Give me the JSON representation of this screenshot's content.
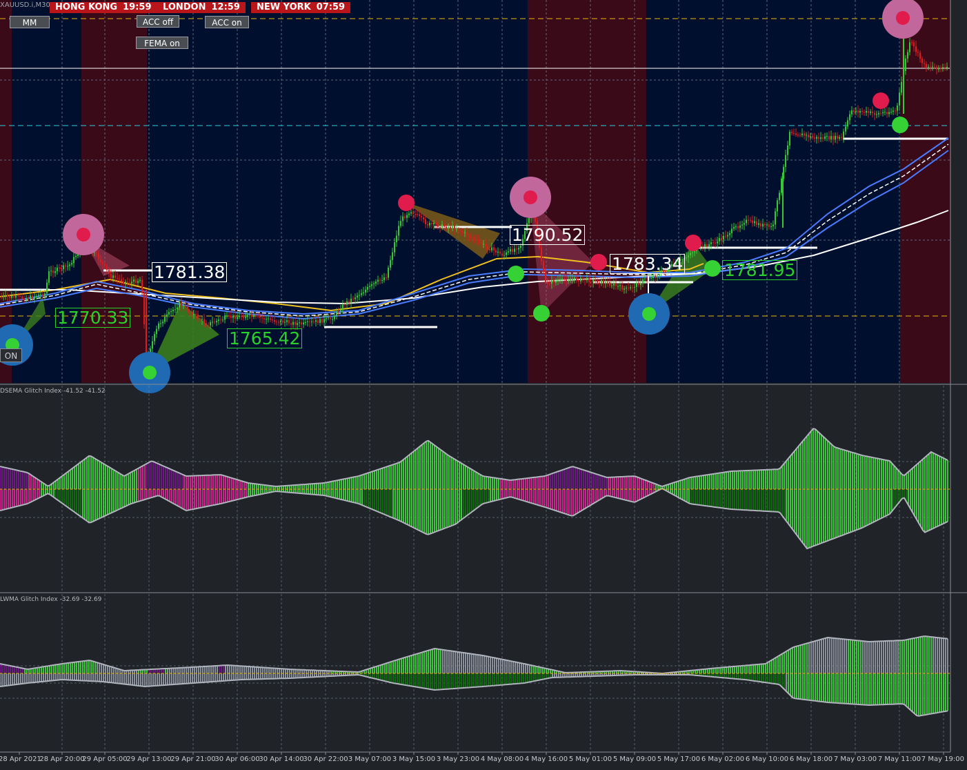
{
  "symbol": "XAUUSD.i,M30",
  "clocks": [
    {
      "city": "HONG KONG",
      "time": "19:59"
    },
    {
      "city": "LONDON",
      "time": "12:59"
    },
    {
      "city": "NEW YORK",
      "time": "07:59"
    }
  ],
  "buttons": {
    "mm": "MM",
    "acc_off": "ACC off",
    "acc_on": "ACC on",
    "fema_on": "FEMA on",
    "on": "ON"
  },
  "price_labels": {
    "p1": "1781.38",
    "p2": "1770.33",
    "p3": "1765.42",
    "p4": "1790.52",
    "p5": "1783.34",
    "p6": "1781.95"
  },
  "indicators": {
    "dsema": "DSEMA Glitch Index -41.52 -41.52",
    "lwma": "LWMA Glitch Index -32.69 -32.69"
  },
  "time_axis": [
    "28 Apr 2021",
    "28 Apr 20:00",
    "29 Apr 05:00",
    "29 Apr 13:00",
    "29 Apr 21:00",
    "30 Apr 06:00",
    "30 Apr 14:00",
    "30 Apr 22:00",
    "3 May 07:00",
    "3 May 15:00",
    "3 May 23:00",
    "4 May 08:00",
    "4 May 16:00",
    "5 May 01:00",
    "5 May 09:00",
    "5 May 17:00",
    "6 May 02:00",
    "6 May 10:00",
    "6 May 18:00",
    "7 May 03:00",
    "7 May 11:00",
    "7 May 19:00"
  ],
  "colors": {
    "background": "#000f2d",
    "session_shade": "#3a0a18",
    "bull": "#35c935",
    "bear": "#e01b1b",
    "osc_green": "#3ec53e",
    "osc_dark_green": "#0f6a0f",
    "osc_magenta": "#c8288c",
    "osc_purple": "#6a1a80",
    "osc_gray": "#8a919c"
  }
}
